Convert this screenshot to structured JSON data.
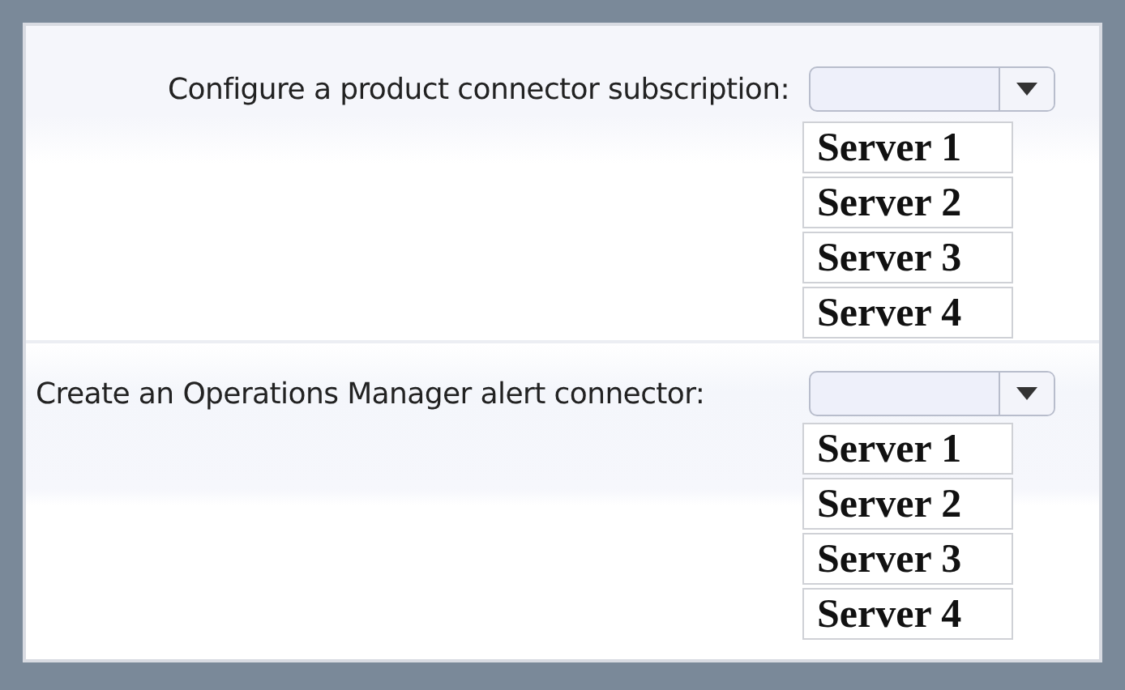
{
  "questions": [
    {
      "label": "Configure a product connector subscription:",
      "options": [
        {
          "label": "Server 1",
          "selected": false
        },
        {
          "label": "Server 2",
          "selected": false
        },
        {
          "label": "Server 3",
          "selected": false
        },
        {
          "label": "Server 4",
          "selected": false
        }
      ]
    },
    {
      "label": "Create an Operations Manager alert connector:",
      "options": [
        {
          "label": "Server 1",
          "selected": false
        },
        {
          "label": "Server 2",
          "selected": false
        },
        {
          "label": "Server 3",
          "selected": false
        },
        {
          "label": "Server 4",
          "selected": false
        }
      ]
    }
  ]
}
